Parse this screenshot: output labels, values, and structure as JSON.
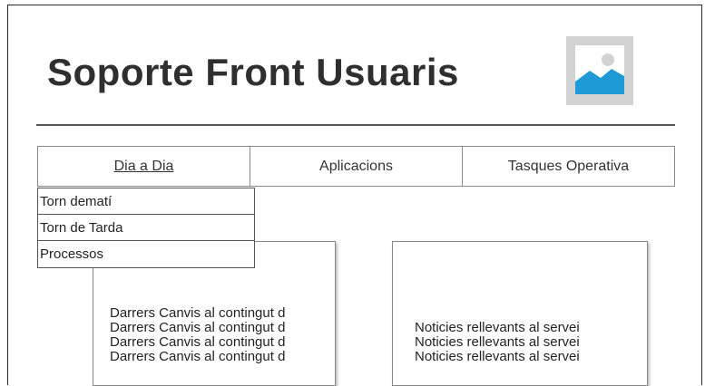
{
  "header": {
    "title": "Soporte Front Usuaris",
    "logo_icon": "image-placeholder-icon"
  },
  "tabs": [
    {
      "label": "Dia a Dia",
      "active": true
    },
    {
      "label": "Aplicacions",
      "active": false
    },
    {
      "label": "Tasques Operativa",
      "active": false
    }
  ],
  "submenu": [
    {
      "label": "Torn dematí"
    },
    {
      "label": "Torn de Tarda"
    },
    {
      "label": "Processos"
    }
  ],
  "left_panel": {
    "lines": [
      "Darrers Canvis al contingut d",
      "Darrers Canvis al contingut d",
      "Darrers Canvis al contingut d",
      "Darrers Canvis al contingut d"
    ]
  },
  "right_panel": {
    "lines": [
      "Noticies rellevants al servei",
      "Noticies rellevants al servei",
      "Noticies rellevants al servei"
    ]
  },
  "colors": {
    "logo_bg": "#d2d2d2",
    "logo_accent": "#1e9ad6"
  }
}
